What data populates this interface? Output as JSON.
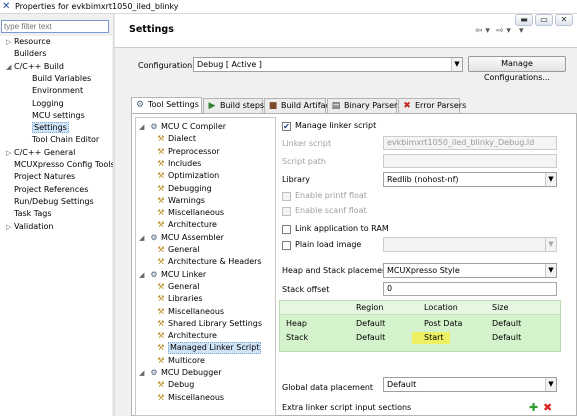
{
  "window": {
    "title": "Properties for evkbimxrt1050_iled_blinky"
  },
  "filter": {
    "placeholder": "type filter text"
  },
  "left_tree": [
    {
      "label": "Resource",
      "toggle": "▷",
      "indent": 0
    },
    {
      "label": "Builders",
      "toggle": "",
      "indent": 0
    },
    {
      "label": "C/C++ Build",
      "toggle": "◢",
      "indent": 0
    },
    {
      "label": "Build Variables",
      "toggle": "",
      "indent": 1
    },
    {
      "label": "Environment",
      "toggle": "",
      "indent": 1
    },
    {
      "label": "Logging",
      "toggle": "",
      "indent": 1
    },
    {
      "label": "MCU settings",
      "toggle": "",
      "indent": 1
    },
    {
      "label": "Settings",
      "toggle": "",
      "indent": 1
    },
    {
      "label": "Tool Chain Editor",
      "toggle": "",
      "indent": 1
    },
    {
      "label": "C/C++ General",
      "toggle": "▷",
      "indent": 0
    },
    {
      "label": "MCUXpresso Config Tools",
      "toggle": "",
      "indent": 0
    },
    {
      "label": "Project Natures",
      "toggle": "",
      "indent": 0
    },
    {
      "label": "Project References",
      "toggle": "",
      "indent": 0
    },
    {
      "label": "Run/Debug Settings",
      "toggle": "",
      "indent": 0
    },
    {
      "label": "Task Tags",
      "toggle": "",
      "indent": 0
    },
    {
      "label": "Validation",
      "toggle": "▷",
      "indent": 0
    }
  ],
  "header": {
    "title": "Settings"
  },
  "configuration": {
    "label": "Configuration:",
    "value": "Debug  [ Active ]",
    "manage_button": "Manage Configurations..."
  },
  "tabs": [
    {
      "label": "Tool Settings",
      "icon": "⚙"
    },
    {
      "label": "Build steps",
      "icon": "▶"
    },
    {
      "label": "Build Artifact",
      "icon": "■"
    },
    {
      "label": "Binary Parsers",
      "icon": "▤"
    },
    {
      "label": "Error Parsers",
      "icon": "✖"
    }
  ],
  "tool_tree": [
    {
      "label": "MCU C Compiler",
      "type": "group"
    },
    {
      "label": "Dialect",
      "type": "leaf"
    },
    {
      "label": "Preprocessor",
      "type": "leaf"
    },
    {
      "label": "Includes",
      "type": "leaf"
    },
    {
      "label": "Optimization",
      "type": "leaf"
    },
    {
      "label": "Debugging",
      "type": "leaf"
    },
    {
      "label": "Warnings",
      "type": "leaf"
    },
    {
      "label": "Miscellaneous",
      "type": "leaf"
    },
    {
      "label": "Architecture",
      "type": "leaf"
    },
    {
      "label": "MCU Assembler",
      "type": "group"
    },
    {
      "label": "General",
      "type": "leaf"
    },
    {
      "label": "Architecture & Headers",
      "type": "leaf"
    },
    {
      "label": "MCU Linker",
      "type": "group"
    },
    {
      "label": "General",
      "type": "leaf"
    },
    {
      "label": "Libraries",
      "type": "leaf"
    },
    {
      "label": "Miscellaneous",
      "type": "leaf"
    },
    {
      "label": "Shared Library Settings",
      "type": "leaf"
    },
    {
      "label": "Architecture",
      "type": "leaf"
    },
    {
      "label": "Managed Linker Script",
      "type": "leaf"
    },
    {
      "label": "Multicore",
      "type": "leaf"
    },
    {
      "label": "MCU Debugger",
      "type": "group"
    },
    {
      "label": "Debug",
      "type": "leaf"
    },
    {
      "label": "Miscellaneous",
      "type": "leaf"
    }
  ],
  "linker": {
    "manage_linker_script": "Manage linker script",
    "linker_script_label": "Linker script",
    "linker_script_value": "evkbimxrt1050_iled_blinky_Debug.ld",
    "script_path_label": "Script path",
    "library_label": "Library",
    "library_value": "Redlib (nohost-nf)",
    "enable_printf_float": "Enable printf float",
    "enable_scanf_float": "Enable scanf float",
    "link_app_to_ram": "Link application to RAM",
    "plain_load_image": "Plain load image",
    "heap_stack_placement_label": "Heap and Stack placement",
    "heap_stack_placement_value": "MCUXpresso Style",
    "stack_offset_label": "Stack offset",
    "stack_offset_value": "0",
    "table": {
      "headers": [
        "Region",
        "Location",
        "Size"
      ],
      "rows": [
        {
          "name": "Heap",
          "region": "Default",
          "location": "Post Data",
          "size": "Default"
        },
        {
          "name": "Stack",
          "region": "Default",
          "location": "Start",
          "size": "Default"
        }
      ]
    },
    "global_data_placement_label": "Global data placement",
    "global_data_placement_value": "Default",
    "extra_sections_label": "Extra linker script input sections"
  },
  "colors": {
    "highlight_start": "#ecf061",
    "table_bg": "#d4f2cc",
    "selection": "#cfe3f7"
  }
}
